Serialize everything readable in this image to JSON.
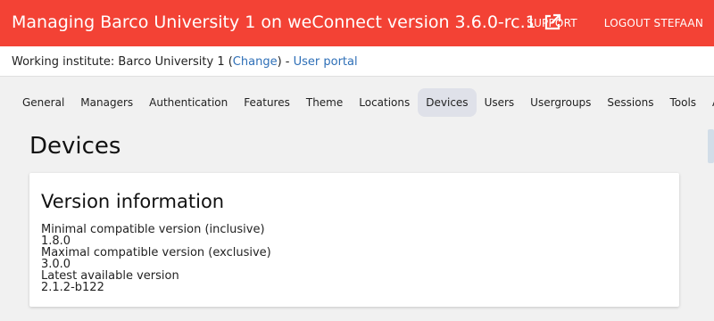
{
  "header": {
    "title": "Managing Barco University 1 on weConnect version 3.6.0-rc.1",
    "external_icon": "external-link-icon",
    "links": [
      "SUPPORT",
      "LOGOUT STEFAAN"
    ],
    "bg_color": "#f34235"
  },
  "subheader": {
    "prefix": "Working institute: Barco University 1 (",
    "change_label": "Change",
    "separator": ") - ",
    "portal_label": "User portal"
  },
  "tabs": [
    "General",
    "Managers",
    "Authentication",
    "Features",
    "Theme",
    "Locations",
    "Devices",
    "Users",
    "Usergroups",
    "Sessions",
    "Tools",
    "Api"
  ],
  "active_tab": "Devices",
  "page": {
    "title": "Devices"
  },
  "version_card": {
    "title": "Version information",
    "lines": [
      "Minimal compatible version (inclusive)",
      "1.8.0",
      "Maximal compatible version (exclusive)",
      "3.0.0",
      "Latest available version",
      "2.1.2-b122"
    ]
  }
}
